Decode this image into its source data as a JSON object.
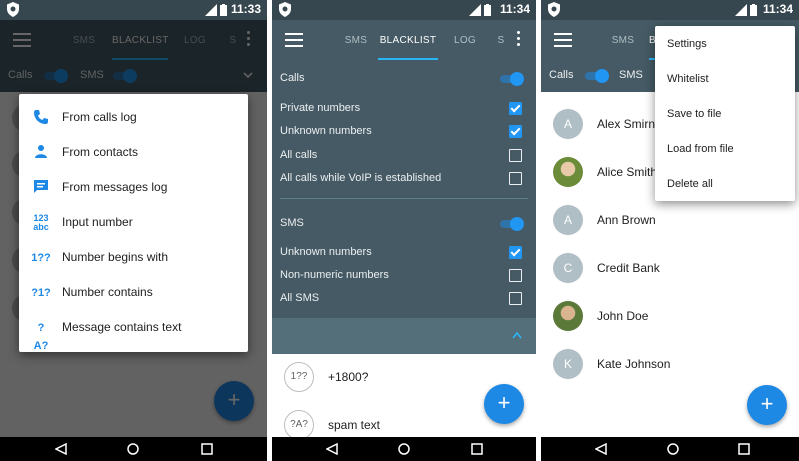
{
  "statusbar": {
    "time_1": "11:33",
    "time_2": "11:34",
    "time_3": "11:34"
  },
  "tabs": {
    "sms": "SMS",
    "blacklist": "BLACKLIST",
    "log": "LOG",
    "overflow": "S"
  },
  "switches": {
    "calls": "Calls",
    "sms": "SMS"
  },
  "add_dialog": {
    "items": [
      {
        "label": "From calls log",
        "icon": "phone-icon"
      },
      {
        "label": "From contacts",
        "icon": "person-icon"
      },
      {
        "label": "From messages log",
        "icon": "message-icon"
      },
      {
        "label": "Input number",
        "icon": "123abc-icon",
        "glyph_top": "123",
        "glyph_bottom": "abc"
      },
      {
        "label": "Number begins with",
        "icon": "begins-with-icon",
        "glyph": "1??"
      },
      {
        "label": "Number contains",
        "icon": "contains-icon",
        "glyph": "?1?"
      },
      {
        "label": "Message contains text",
        "icon": "text-contains-icon",
        "glyph": "?A?"
      }
    ]
  },
  "settings": {
    "calls_header": "Calls",
    "calls_enabled": true,
    "calls_options": [
      {
        "label": "Private numbers",
        "checked": true
      },
      {
        "label": "Unknown numbers",
        "checked": true
      },
      {
        "label": "All calls",
        "checked": false
      },
      {
        "label": "All calls while VoIP is established",
        "checked": false
      }
    ],
    "sms_header": "SMS",
    "sms_enabled": true,
    "sms_options": [
      {
        "label": "Unknown numbers",
        "checked": true
      },
      {
        "label": "Non-numeric numbers",
        "checked": false
      },
      {
        "label": "All SMS",
        "checked": false
      }
    ]
  },
  "blacklist": [
    {
      "glyph": "1??",
      "value": "+1800?"
    },
    {
      "glyph": "?A?",
      "value": "spam text"
    }
  ],
  "contacts": [
    {
      "initial": "A",
      "name": "Alex Smirnov",
      "photo": false
    },
    {
      "initial": "",
      "name": "Alice Smith",
      "photo": true
    },
    {
      "initial": "A",
      "name": "Ann Brown",
      "photo": false
    },
    {
      "initial": "C",
      "name": "Credit Bank",
      "photo": false
    },
    {
      "initial": "",
      "name": "John Doe",
      "photo": true
    },
    {
      "initial": "K",
      "name": "Kate Johnson",
      "photo": false
    }
  ],
  "overflow_menu": [
    "Settings",
    "Whitelist",
    "Save to file",
    "Load from file",
    "Delete all"
  ],
  "fab_label": "+",
  "colors": {
    "toolbar": "#455a64",
    "statusbar": "#37474f",
    "accent": "#1e88e5"
  }
}
